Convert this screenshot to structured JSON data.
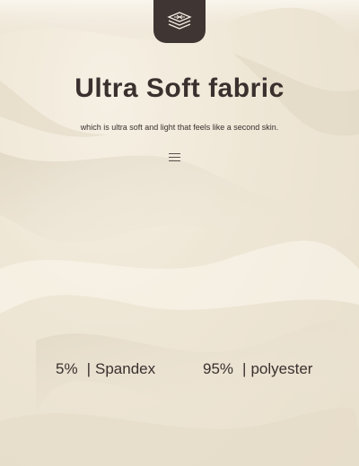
{
  "badge": {
    "icon": "fabric-layers-icon"
  },
  "title": "Ultra Soft fabric",
  "subtitle": "which is ultra soft and light that feels like a second skin.",
  "menu": {
    "icon": "menu-icon"
  },
  "composition": [
    {
      "percent": "5%",
      "material": "Spandex"
    },
    {
      "percent": "95%",
      "material": "polyester"
    }
  ],
  "colors": {
    "badge": "#3f3533",
    "text": "#3a302e",
    "background": "#efe7d6"
  }
}
